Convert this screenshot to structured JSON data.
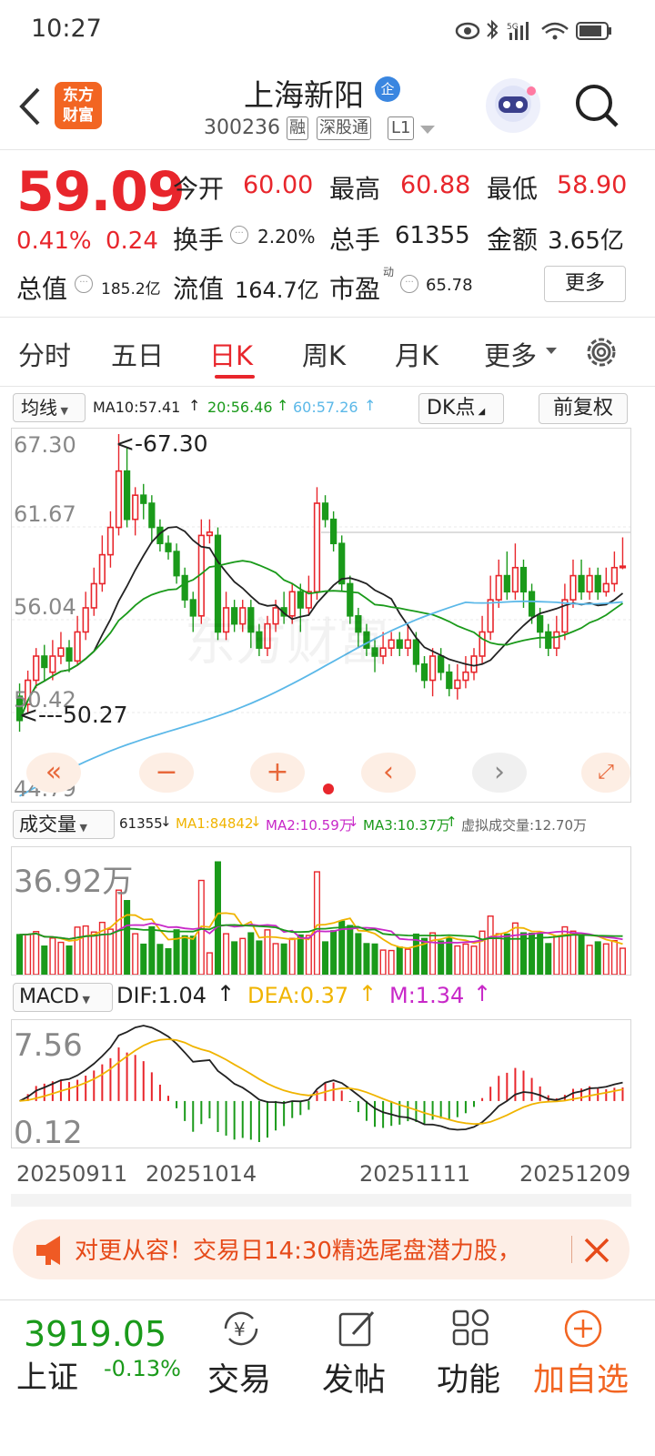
{
  "status": {
    "time": "10:27",
    "net": "5G"
  },
  "header": {
    "logo_line1": "东方",
    "logo_line2": "财富",
    "title": "上海新阳",
    "badge": "企",
    "code": "300236",
    "tags": [
      "融",
      "深股通",
      "L1"
    ]
  },
  "quote": {
    "price": "59.09",
    "change_pct": "0.41%",
    "change": "0.24",
    "fields": [
      {
        "label": "今开",
        "value": "60.00"
      },
      {
        "label": "最高",
        "value": "60.88"
      },
      {
        "label": "最低",
        "value": "58.90"
      },
      {
        "label": "换手",
        "value": "2.20%"
      },
      {
        "label": "总手",
        "value": "61355"
      },
      {
        "label": "金额",
        "value": "3.65亿"
      },
      {
        "label": "总值",
        "value": "185.2亿"
      },
      {
        "label": "流值",
        "value": "164.7亿"
      },
      {
        "label": "市盈",
        "sup": "动",
        "value": "65.78"
      }
    ],
    "more": "更多"
  },
  "tabs": [
    "分时",
    "五日",
    "日K",
    "周K",
    "月K",
    "更多"
  ],
  "kline": {
    "ma_select": "均线",
    "ma10": "MA10:57.41",
    "ma20": "20:56.46",
    "ma60": "60:57.26",
    "dk": "DK点",
    "fq": "前复权",
    "y_labels": [
      "67.30",
      "61.67",
      "56.04",
      "50.42",
      "44.79"
    ],
    "high_note": "<-67.30",
    "low_note": "<---50.27"
  },
  "volume": {
    "select": "成交量",
    "vol": "61355",
    "ma1": "MA1:84842",
    "ma2": "MA2:10.59万",
    "ma3": "MA3:10.37万",
    "virtual": "虚拟成交量:12.70万",
    "top": "36.92万"
  },
  "macd": {
    "select": "MACD",
    "dif": "DIF:1.04",
    "dea": "DEA:0.37",
    "m": "M:1.34",
    "top": "7.56",
    "bottom": "0.12"
  },
  "dates": [
    "20250911",
    "20251014",
    "20251111",
    "20251209"
  ],
  "banner": {
    "text": "对更从容！交易日14:30精选尾盘潜力股，"
  },
  "bottom": {
    "index_value": "3919.05",
    "index_name": "上证",
    "index_change": "-0.13%",
    "trade": "交易",
    "post": "发帖",
    "func": "功能",
    "add": "加自选"
  },
  "colors": {
    "up": "#e8262c",
    "down": "#1a9a1a",
    "accent": "#f26522",
    "ma10": "#222222",
    "ma20": "#1a9a1a",
    "ma60": "#5bb8e8",
    "ma1": "#f0b400",
    "ma2": "#c828c8"
  },
  "chart_data": {
    "type": "candlestick",
    "ylim": [
      44.79,
      67.3
    ],
    "candles": [
      [
        51,
        49.5,
        51.8,
        48.8
      ],
      [
        50.5,
        52,
        52.6,
        50
      ],
      [
        52,
        53.5,
        54,
        51.5
      ],
      [
        53.5,
        52.8,
        54.2,
        52
      ],
      [
        52.5,
        53.5,
        54.5,
        52
      ],
      [
        53.5,
        54,
        55,
        53
      ],
      [
        54,
        53.2,
        54.5,
        52.5
      ],
      [
        53.2,
        55,
        56,
        53
      ],
      [
        55,
        56.5,
        57.5,
        54.5
      ],
      [
        56.5,
        58,
        59,
        56
      ],
      [
        58,
        59.8,
        61,
        57.5
      ],
      [
        59.8,
        61.5,
        62.5,
        59
      ],
      [
        61.5,
        65,
        67.3,
        61
      ],
      [
        65,
        62,
        66.5,
        61.5
      ],
      [
        62,
        63.5,
        64,
        61
      ],
      [
        63.5,
        63,
        64.2,
        62
      ],
      [
        63,
        61.5,
        63.5,
        60.5
      ],
      [
        61.5,
        60.5,
        62,
        60
      ],
      [
        60.5,
        60,
        61,
        59.5
      ],
      [
        60,
        58.5,
        60.5,
        58
      ],
      [
        58.5,
        57,
        59,
        56.5
      ],
      [
        57,
        56,
        57.5,
        55
      ],
      [
        56,
        61,
        62,
        55.5
      ],
      [
        61,
        61.2,
        62,
        60.5
      ],
      [
        61,
        55,
        61.5,
        54.5
      ],
      [
        55,
        56.5,
        57.5,
        54.5
      ],
      [
        56.5,
        55.5,
        57,
        55
      ],
      [
        55.5,
        56.5,
        57,
        55
      ],
      [
        56.5,
        55,
        57,
        54
      ],
      [
        55,
        54,
        55.5,
        53.5
      ],
      [
        54,
        55.5,
        56,
        53.5
      ],
      [
        55.5,
        56.5,
        57,
        55
      ],
      [
        56.5,
        56,
        57.5,
        55.5
      ],
      [
        56,
        57.5,
        58,
        55.5
      ],
      [
        57.5,
        56.5,
        58,
        55
      ],
      [
        56.5,
        57.5,
        58.5,
        56
      ],
      [
        57.5,
        63,
        64,
        57
      ],
      [
        63,
        62,
        63.5,
        61.5
      ],
      [
        62,
        60.5,
        62.5,
        60
      ],
      [
        60.5,
        58,
        61,
        57.5
      ],
      [
        58,
        56,
        58.5,
        55.5
      ],
      [
        56,
        55,
        56.5,
        54
      ],
      [
        55,
        54,
        55.5,
        53.5
      ],
      [
        54,
        53.5,
        54.5,
        52.5
      ],
      [
        53.5,
        54,
        55,
        53
      ],
      [
        54,
        54.5,
        55,
        53.5
      ],
      [
        54.5,
        54,
        55,
        53.5
      ],
      [
        54,
        54.5,
        55.5,
        53.5
      ],
      [
        54.5,
        53,
        55,
        52.5
      ],
      [
        53,
        52,
        53.5,
        51.5
      ],
      [
        52,
        53.5,
        54,
        51
      ],
      [
        53.5,
        52.5,
        54,
        52
      ],
      [
        52.5,
        51.5,
        53,
        51
      ],
      [
        51.5,
        52,
        53,
        50.8
      ],
      [
        52,
        52.5,
        53.5,
        51.5
      ],
      [
        52.5,
        53.5,
        54,
        52
      ],
      [
        53.5,
        55,
        56,
        53
      ],
      [
        55,
        57,
        58.5,
        54.5
      ],
      [
        57,
        58.5,
        59.5,
        56.5
      ],
      [
        58.5,
        57.5,
        60,
        57
      ],
      [
        57.5,
        59,
        60.5,
        57
      ],
      [
        59,
        57.5,
        59.5,
        56.5
      ],
      [
        57.5,
        56,
        58,
        55.5
      ],
      [
        56,
        55,
        56.5,
        54
      ],
      [
        55,
        54,
        55.5,
        53.5
      ],
      [
        54,
        55,
        56,
        53.5
      ],
      [
        55,
        57,
        58,
        54.5
      ],
      [
        57,
        58.5,
        59.5,
        56.5
      ],
      [
        58.5,
        57.5,
        59.5,
        57
      ],
      [
        57.5,
        58.5,
        59,
        57
      ],
      [
        58.5,
        57.5,
        59,
        57
      ],
      [
        57.5,
        58,
        59,
        57.2
      ],
      [
        58,
        59,
        60,
        57.5
      ],
      [
        59,
        59.09,
        60.88,
        58.9
      ]
    ]
  }
}
